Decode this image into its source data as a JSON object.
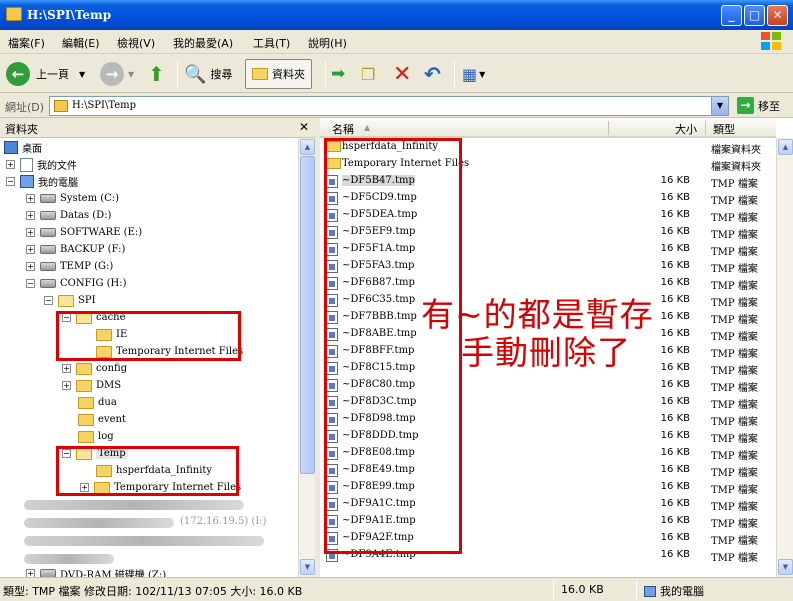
{
  "window": {
    "title": "H:\\SPI\\Temp",
    "controls": [
      "_",
      "□",
      "✕"
    ]
  },
  "menu": [
    "檔案(F)",
    "編輯(E)",
    "檢視(V)",
    "我的最愛(A)",
    "工具(T)",
    "說明(H)"
  ],
  "toolbar": {
    "back_label": "上一頁",
    "search_label": "搜尋",
    "folders_label": "資料夾"
  },
  "address": {
    "label": "網址(D)",
    "value": "H:\\SPI\\Temp",
    "go_label": "移至"
  },
  "left_pane": {
    "title": "資料夾",
    "close": "✕",
    "tree": [
      {
        "label": "桌面"
      },
      {
        "label": "我的文件",
        "expander": "+"
      },
      {
        "label": "我的電腦",
        "expander": "−"
      },
      {
        "label": "System (C:)",
        "expander": "+"
      },
      {
        "label": "Datas (D:)",
        "expander": "+"
      },
      {
        "label": "SOFTWARE (E:)",
        "expander": "+"
      },
      {
        "label": "BACKUP (F:)",
        "expander": "+"
      },
      {
        "label": "TEMP (G:)",
        "expander": "+"
      },
      {
        "label": "CONFIG (H:)",
        "expander": "−"
      },
      {
        "label": "SPI",
        "expander": "−"
      },
      {
        "label": "cache",
        "expander": "−"
      },
      {
        "label": "IE"
      },
      {
        "label": "Temporary Internet Files"
      },
      {
        "label": "config",
        "expander": "+"
      },
      {
        "label": "DMS",
        "expander": "+"
      },
      {
        "label": "dua"
      },
      {
        "label": "event"
      },
      {
        "label": "log"
      },
      {
        "label": "Temp",
        "expander": "−"
      },
      {
        "label": "hsperfdata_Infinity"
      },
      {
        "label": "Temporary Internet Files",
        "expander": "+"
      },
      {
        "label": "DVD-RAM 磁碟機 (Z:)",
        "expander": "+"
      }
    ],
    "blurred_text": "(172.16.19.5) (I:)"
  },
  "right_pane": {
    "columns": {
      "name": "名稱",
      "size": "大小",
      "type": "類型"
    },
    "files": [
      {
        "name": "hsperfdata_Infinity",
        "size": "",
        "type": "檔案資料夾",
        "kind": "folder"
      },
      {
        "name": "Temporary Internet Files",
        "size": "",
        "type": "檔案資料夾",
        "kind": "folder"
      },
      {
        "name": "~DF5B47.tmp",
        "size": "16 KB",
        "type": "TMP 檔案",
        "kind": "tmp",
        "selected": true
      },
      {
        "name": "~DF5CD9.tmp",
        "size": "16 KB",
        "type": "TMP 檔案",
        "kind": "tmp"
      },
      {
        "name": "~DF5DEA.tmp",
        "size": "16 KB",
        "type": "TMP 檔案",
        "kind": "tmp"
      },
      {
        "name": "~DF5EF9.tmp",
        "size": "16 KB",
        "type": "TMP 檔案",
        "kind": "tmp"
      },
      {
        "name": "~DF5F1A.tmp",
        "size": "16 KB",
        "type": "TMP 檔案",
        "kind": "tmp"
      },
      {
        "name": "~DF5FA3.tmp",
        "size": "16 KB",
        "type": "TMP 檔案",
        "kind": "tmp"
      },
      {
        "name": "~DF6B87.tmp",
        "size": "16 KB",
        "type": "TMP 檔案",
        "kind": "tmp"
      },
      {
        "name": "~DF6C35.tmp",
        "size": "16 KB",
        "type": "TMP 檔案",
        "kind": "tmp"
      },
      {
        "name": "~DF7BBB.tmp",
        "size": "16 KB",
        "type": "TMP 檔案",
        "kind": "tmp"
      },
      {
        "name": "~DF8ABE.tmp",
        "size": "16 KB",
        "type": "TMP 檔案",
        "kind": "tmp"
      },
      {
        "name": "~DF8BFF.tmp",
        "size": "16 KB",
        "type": "TMP 檔案",
        "kind": "tmp"
      },
      {
        "name": "~DF8C15.tmp",
        "size": "16 KB",
        "type": "TMP 檔案",
        "kind": "tmp"
      },
      {
        "name": "~DF8C80.tmp",
        "size": "16 KB",
        "type": "TMP 檔案",
        "kind": "tmp"
      },
      {
        "name": "~DF8D3C.tmp",
        "size": "16 KB",
        "type": "TMP 檔案",
        "kind": "tmp"
      },
      {
        "name": "~DF8D98.tmp",
        "size": "16 KB",
        "type": "TMP 檔案",
        "kind": "tmp"
      },
      {
        "name": "~DF8DDD.tmp",
        "size": "16 KB",
        "type": "TMP 檔案",
        "kind": "tmp"
      },
      {
        "name": "~DF8E08.tmp",
        "size": "16 KB",
        "type": "TMP 檔案",
        "kind": "tmp"
      },
      {
        "name": "~DF8E49.tmp",
        "size": "16 KB",
        "type": "TMP 檔案",
        "kind": "tmp"
      },
      {
        "name": "~DF8E99.tmp",
        "size": "16 KB",
        "type": "TMP 檔案",
        "kind": "tmp"
      },
      {
        "name": "~DF9A1C.tmp",
        "size": "16 KB",
        "type": "TMP 檔案",
        "kind": "tmp"
      },
      {
        "name": "~DF9A1E.tmp",
        "size": "16 KB",
        "type": "TMP 檔案",
        "kind": "tmp"
      },
      {
        "name": "~DF9A2F.tmp",
        "size": "16 KB",
        "type": "TMP 檔案",
        "kind": "tmp"
      },
      {
        "name": "~DF9A4E.tmp",
        "size": "16 KB",
        "type": "TMP 檔案",
        "kind": "tmp"
      }
    ]
  },
  "annotation": {
    "line1": "有~的都是暫存",
    "line2": "手動刪除了"
  },
  "status": {
    "details": "類型: TMP 檔案 修改日期: 102/11/13 07:05 大小: 16.0 KB",
    "size": "16.0 KB",
    "zone": "我的電腦"
  },
  "colors": {
    "title_blue": "#0054e3",
    "highlight_red": "#e00000",
    "annotation_red": "#d80000"
  }
}
